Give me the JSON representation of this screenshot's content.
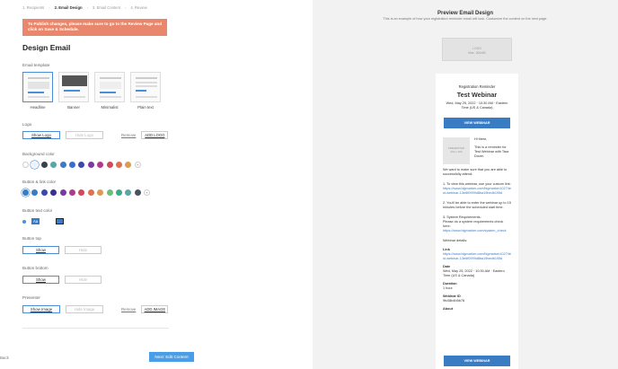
{
  "steps": [
    {
      "label": "1. Recipients",
      "active": false
    },
    {
      "label": "2. Email Design",
      "active": true
    },
    {
      "label": "3. Email Content",
      "active": false
    },
    {
      "label": "4. Review",
      "active": false
    }
  ],
  "banner": "To Publish changes, please make sure to go to the Review Page and click on Save & Schedule.",
  "heading": "Design Email",
  "template": {
    "label": "Email template",
    "options": [
      {
        "name": "Headline",
        "selected": true
      },
      {
        "name": "Banner",
        "selected": false
      },
      {
        "name": "Minimalist",
        "selected": false
      },
      {
        "name": "Plain text",
        "selected": false
      }
    ]
  },
  "logo": {
    "label": "Logo",
    "show": "Show Logo",
    "hide": "Hide Logo",
    "remove": "Remove",
    "add": "ADD LOGO"
  },
  "background_color": {
    "label": "Background color",
    "colors": [
      "#ffffff",
      "#eef3fb",
      "#3a3f4a",
      "#5aa6a6",
      "#3a7cc4",
      "#3a6fd1",
      "#3a48b0",
      "#7a3aa0",
      "#b03a8a",
      "#d04a5a",
      "#e07050",
      "#e09a50"
    ],
    "selected_index": 1
  },
  "button_color": {
    "label": "Button & link color",
    "colors": [
      "#3a7cc4",
      "#3a7cc4",
      "#3a48b0",
      "#3a2f90",
      "#7a3aa0",
      "#b03a8a",
      "#d04a5a",
      "#e07050",
      "#e09a50",
      "#6abf7a",
      "#3fa88a",
      "#5aa6a6",
      "#4a5260"
    ],
    "selected_index": 0
  },
  "button_text_color": {
    "label": "Button text color",
    "option1": "Aa",
    "option2": "Aa"
  },
  "button_top": {
    "label": "Button top",
    "show": "Show",
    "hide": "Hide"
  },
  "button_bottom": {
    "label": "Button bottom",
    "show": "Show",
    "hide": "Hide"
  },
  "presenter": {
    "label": "Presenter",
    "show": "Show Image",
    "hide": "Hide Image",
    "remove": "Remove",
    "add": "ADD IMAGE"
  },
  "footer": {
    "back": "Back",
    "next": "Next: Edit Content"
  },
  "preview": {
    "title": "Preview Email Design",
    "subtitle": "This is an example of how your registration reminder email will look. Customize the content on the next page.",
    "logo_placeholder": "LOGO",
    "logo_size": "Max. 300x80",
    "kicker": "Registration Reminder",
    "webinar_title": "Test Webinar",
    "date": "Wed, May 25, 2022 · 10:30 AM · Eastern Time (US & Canada)",
    "button": "VIEW WEBINAR",
    "presenter_label": "PRESENTER",
    "presenter_size": "300 x 300",
    "greeting": "Hi there,",
    "body1": "This is a reminder for Test Webinar with Tara Dover.",
    "body2": "We want to make sure that you are able to successfully attend:",
    "step1": "1. To view this webinar, use your custom link:",
    "link1": "https://www.bigmarker.com/bigmarker1027/test-webinar-13e6f0999d8ba19bedb195d",
    "step2": "2. You'll be able to enter the webinar up to 15 minutes before the scheduled start time.",
    "step3": "3. System Requirements:",
    "step3b": "Please do a system requirements check here:",
    "link2": "https://www.bigmarker.com/system_check",
    "details": "Webinar details:",
    "link_label": "Link",
    "link3": "https://www.bigmarker.com/bigmarker1027/test-webinar-13e6f0999d8ba19bedb195d",
    "date_label": "Date",
    "date_value": "Wed, May 25, 2022 · 10:30 AM · Eastern Time (US & Canada)",
    "duration_label": "Duration",
    "duration_value": "1 hour",
    "id_label": "Webinar ID",
    "id_value": "9fc08b4b5b78",
    "about_label": "About",
    "button2": "VIEW WEBINAR"
  }
}
